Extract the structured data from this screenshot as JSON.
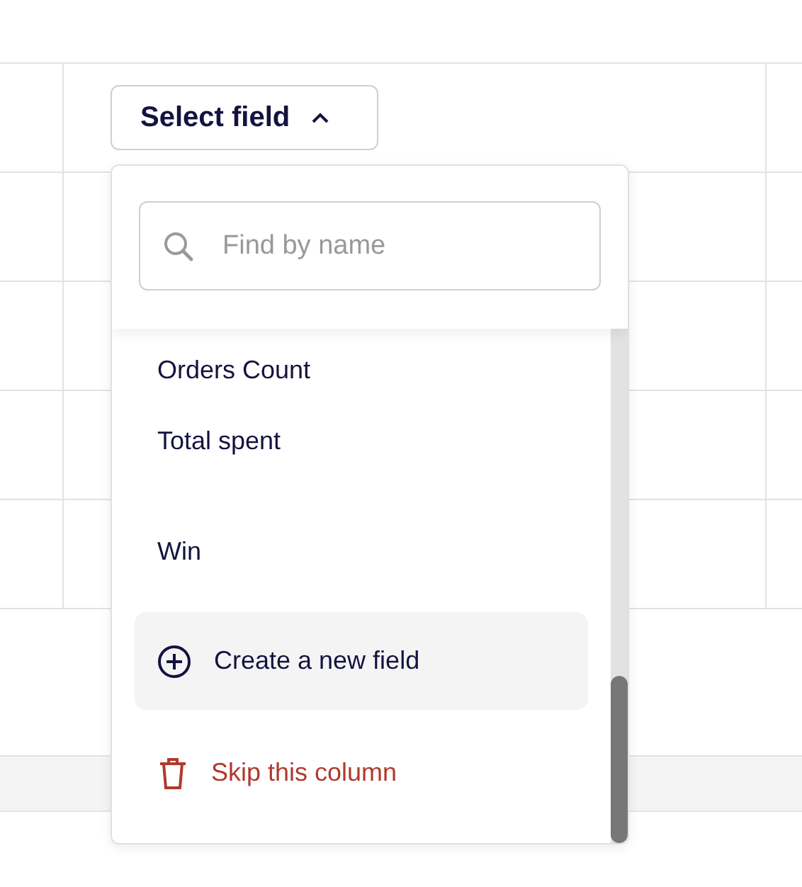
{
  "button": {
    "label": "Select field",
    "expanded": true
  },
  "search": {
    "placeholder": "Find by name"
  },
  "fields": [
    {
      "label": "Orders Count",
      "selected": false
    },
    {
      "label": "Total spent",
      "selected": false
    },
    {
      "label": "Win",
      "selected": false
    }
  ],
  "actions": [
    {
      "kind": "create",
      "label": "Create a new field",
      "selected": true
    },
    {
      "kind": "skip",
      "label": "Skip this column",
      "selected": false
    }
  ]
}
